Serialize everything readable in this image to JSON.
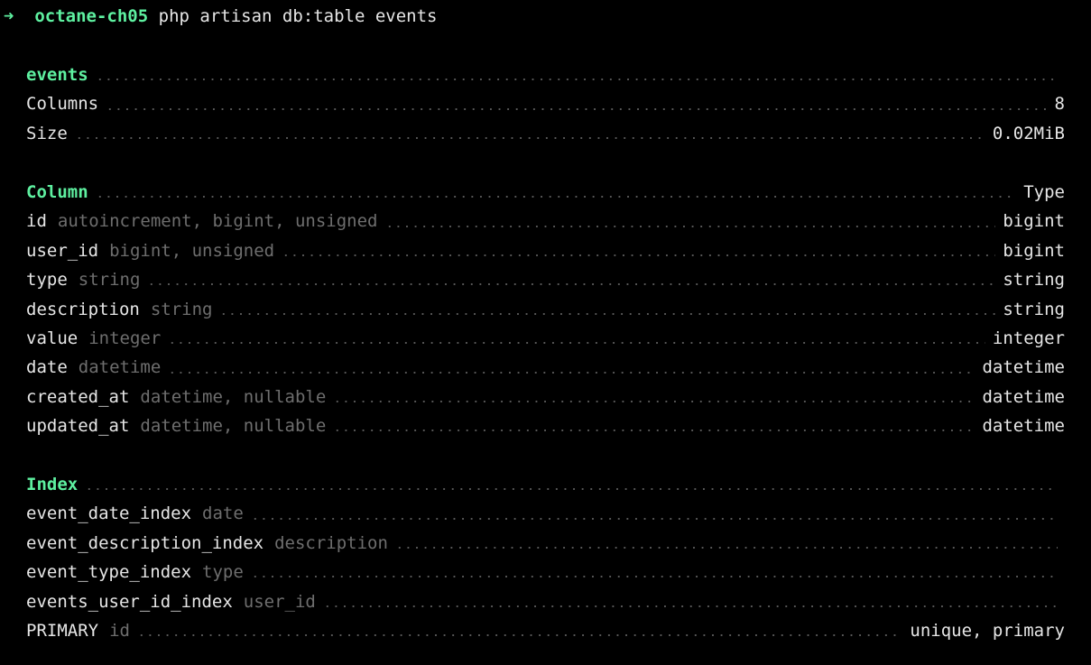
{
  "prompt": {
    "arrow": "➜",
    "dir": "octane-ch05",
    "command": "php artisan db:table events"
  },
  "table": {
    "name": "events",
    "stats": [
      {
        "label": "Columns",
        "value": "8"
      },
      {
        "label": "Size",
        "value": "0.02MiB"
      }
    ]
  },
  "columns": {
    "heading": "Column",
    "type_heading": "Type",
    "rows": [
      {
        "name": "id",
        "attrs": "autoincrement, bigint, unsigned",
        "type": "bigint"
      },
      {
        "name": "user_id",
        "attrs": "bigint, unsigned",
        "type": "bigint"
      },
      {
        "name": "type",
        "attrs": "string",
        "type": "string"
      },
      {
        "name": "description",
        "attrs": "string",
        "type": "string"
      },
      {
        "name": "value",
        "attrs": "integer",
        "type": "integer"
      },
      {
        "name": "date",
        "attrs": "datetime",
        "type": "datetime"
      },
      {
        "name": "created_at",
        "attrs": "datetime, nullable",
        "type": "datetime"
      },
      {
        "name": "updated_at",
        "attrs": "datetime, nullable",
        "type": "datetime"
      }
    ]
  },
  "indexes": {
    "heading": "Index",
    "rows": [
      {
        "name": "event_date_index",
        "attrs": "date",
        "type": ""
      },
      {
        "name": "event_description_index",
        "attrs": "description",
        "type": ""
      },
      {
        "name": "event_type_index",
        "attrs": "type",
        "type": ""
      },
      {
        "name": "events_user_id_index",
        "attrs": "user_id",
        "type": ""
      },
      {
        "name": "PRIMARY",
        "attrs": "id",
        "type": "unique, primary"
      }
    ]
  }
}
